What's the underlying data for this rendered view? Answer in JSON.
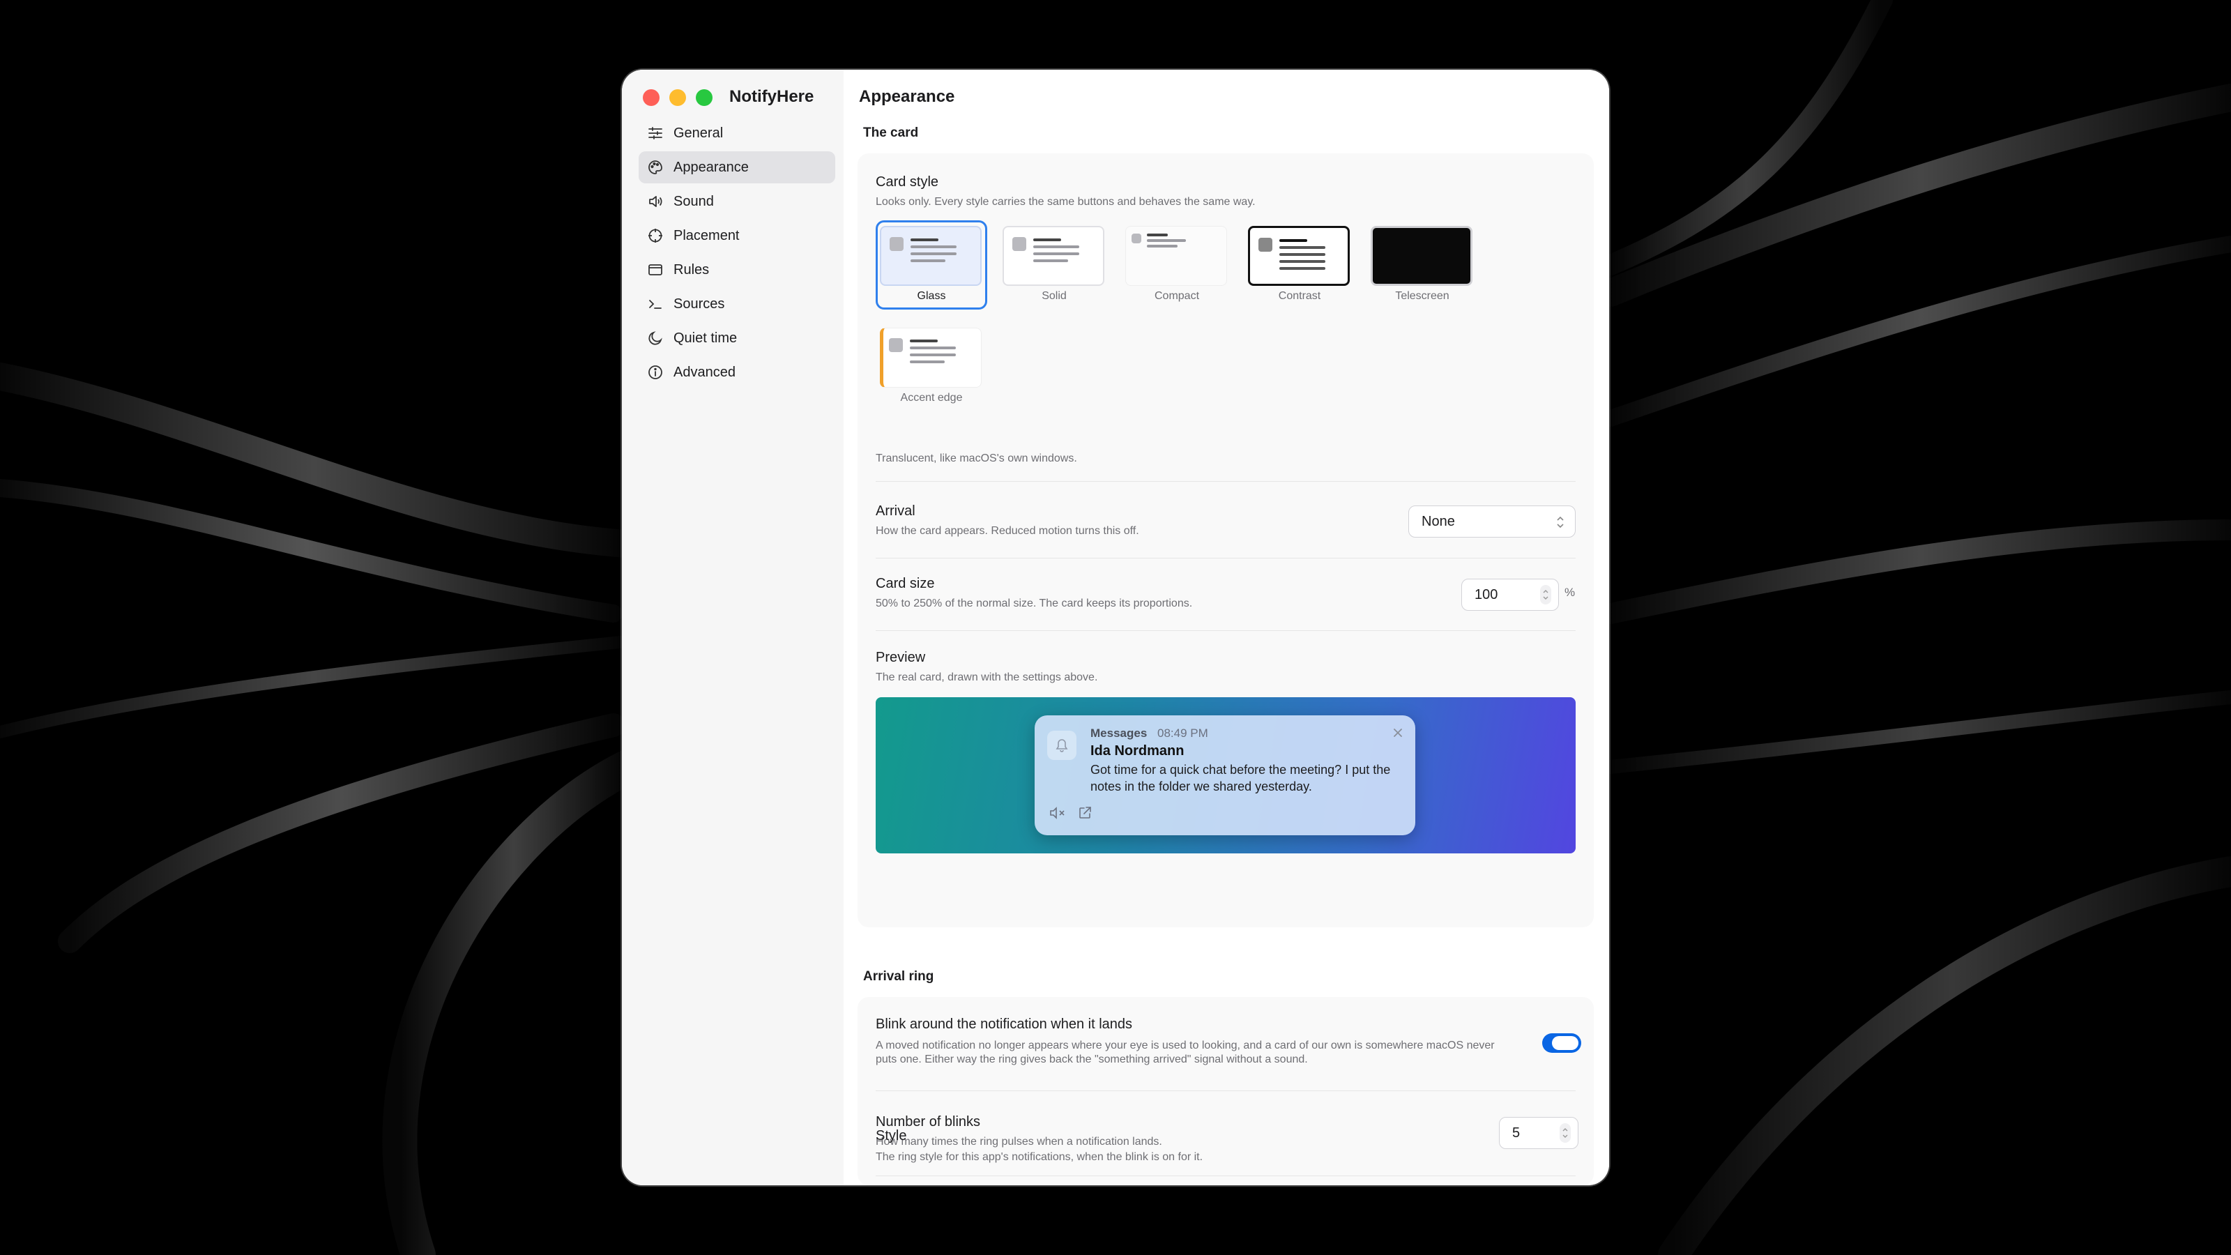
{
  "window": {
    "app_name": "NotifyHere"
  },
  "sidebar": {
    "items": [
      {
        "label": "General",
        "icon": "sliders-icon"
      },
      {
        "label": "Appearance",
        "icon": "palette-icon",
        "active": true
      },
      {
        "label": "Sound",
        "icon": "speaker-icon"
      },
      {
        "label": "Placement",
        "icon": "crosshair-icon"
      },
      {
        "label": "Rules",
        "icon": "tray-icon"
      },
      {
        "label": "Sources",
        "icon": "terminal-icon"
      },
      {
        "label": "Quiet time",
        "icon": "moon-icon"
      },
      {
        "label": "Advanced",
        "icon": "info-icon"
      }
    ]
  },
  "main": {
    "title": "Appearance",
    "card_section": {
      "title": "The card",
      "card_style": {
        "label": "Card style",
        "description": "Looks only. Every style carries the same buttons and behaves the same way.",
        "options": [
          "Glass",
          "Solid",
          "Compact",
          "Contrast",
          "Telescreen",
          "Accent edge"
        ],
        "selected": "Glass",
        "selected_description": "Translucent, like macOS's own windows."
      },
      "arrival": {
        "label": "Arrival",
        "description": "How the card appears. Reduced motion turns this off.",
        "value": "None"
      },
      "card_size": {
        "label": "Card size",
        "description": "50% to 250% of the normal size. The card keeps its proportions.",
        "value": "100",
        "unit": "%"
      },
      "preview": {
        "label": "Preview",
        "description": "The real card, drawn with the settings above.",
        "notification": {
          "app": "Messages",
          "time": "08:49 PM",
          "sender": "Ida Nordmann",
          "body": "Got time for a quick chat before the meeting? I put the notes in the folder we shared yesterday."
        }
      }
    },
    "ring_section": {
      "title": "Arrival ring",
      "blink": {
        "label": "Blink around the notification when it lands",
        "description": "A moved notification no longer appears where your eye is used to looking, and a card of our own is somewhere macOS never puts one. Either way the ring gives back the \"something arrived\" signal without a sound.",
        "enabled": true
      },
      "blinks": {
        "label": "Number of blinks",
        "description": "How many times the ring pulses when a notification lands.",
        "value": "5"
      },
      "style": {
        "label": "Style",
        "description": "The ring style for this app's notifications, when the blink is on for it."
      }
    }
  },
  "colors": {
    "accent": "#2f80ed",
    "toggle_on": "#0a66e4",
    "close_red": "#fe5f57",
    "minimize_yellow": "#febc2e",
    "zoom_green": "#28c840"
  }
}
